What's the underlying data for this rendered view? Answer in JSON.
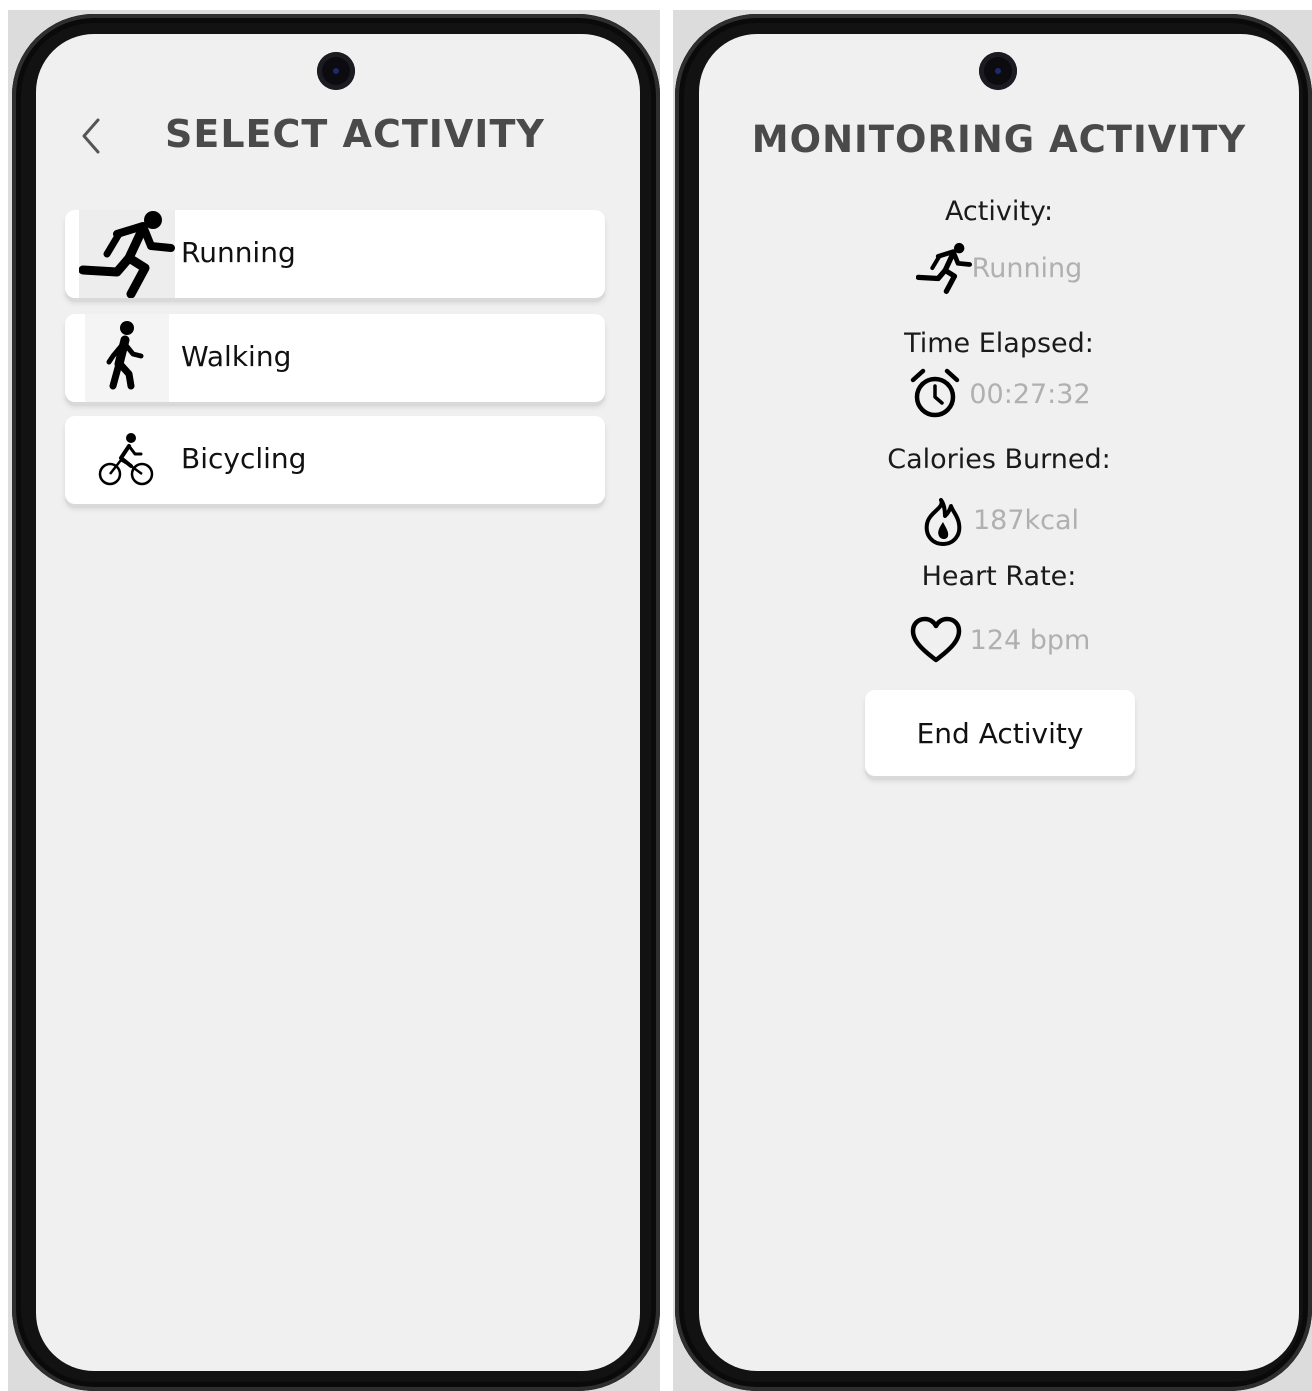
{
  "select_screen": {
    "title": "SELECT ACTIVITY",
    "back_icon": "chevron-left-icon",
    "activities": [
      {
        "label": "Running",
        "icon": "running-icon"
      },
      {
        "label": "Walking",
        "icon": "walking-icon"
      },
      {
        "label": "Bicycling",
        "icon": "bicycling-icon"
      }
    ]
  },
  "monitor_screen": {
    "title": "MONITORING ACTIVITY",
    "activity": {
      "label": "Activity:",
      "value": "Running",
      "icon": "running-icon"
    },
    "time_elapsed": {
      "label": "Time Elapsed:",
      "value": "00:27:32",
      "icon": "alarm-clock-icon"
    },
    "calories": {
      "label": "Calories Burned:",
      "value": "187kcal",
      "icon": "flame-icon"
    },
    "heart_rate": {
      "label": "Heart Rate:",
      "value": "124 bpm",
      "icon": "heart-icon"
    },
    "end_button_label": "End Activity"
  },
  "colors": {
    "screen_background": "#f0f0f0",
    "title_text": "#4a4a4a",
    "muted_value_text": "#b0b0b0",
    "card_background": "#ffffff",
    "phone_frame": "#121212"
  }
}
